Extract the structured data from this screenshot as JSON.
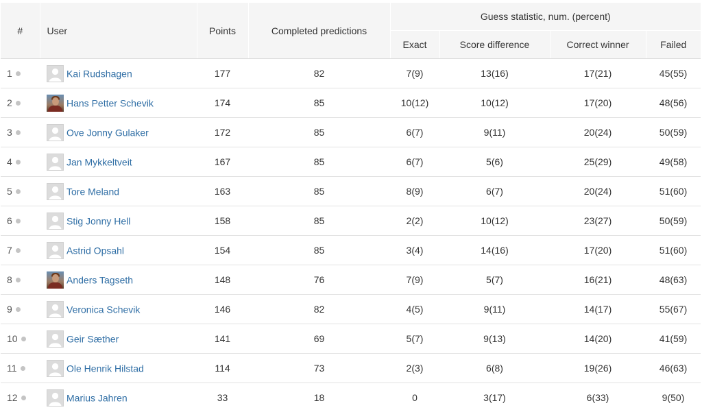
{
  "headers": {
    "rank": "#",
    "user": "User",
    "points": "Points",
    "completed": "Completed predictions",
    "group": "Guess statistic, num. (percent)",
    "exact": "Exact",
    "score_difference": "Score difference",
    "correct_winner": "Correct winner",
    "failed": "Failed"
  },
  "rows": [
    {
      "rank": "1",
      "name": "Kai Rudshagen",
      "avatar": "default-avatar-icon",
      "points": "177",
      "completed": "82",
      "exact": "7(9)",
      "score_difference": "13(16)",
      "correct_winner": "17(21)",
      "failed": "45(55)"
    },
    {
      "rank": "2",
      "name": "Hans Petter Schevik",
      "avatar": "photo-avatar",
      "points": "174",
      "completed": "85",
      "exact": "10(12)",
      "score_difference": "10(12)",
      "correct_winner": "17(20)",
      "failed": "48(56)"
    },
    {
      "rank": "3",
      "name": "Ove Jonny Gulaker",
      "avatar": "default-avatar-icon",
      "points": "172",
      "completed": "85",
      "exact": "6(7)",
      "score_difference": "9(11)",
      "correct_winner": "20(24)",
      "failed": "50(59)"
    },
    {
      "rank": "4",
      "name": "Jan Mykkeltveit",
      "avatar": "default-avatar-icon",
      "points": "167",
      "completed": "85",
      "exact": "6(7)",
      "score_difference": "5(6)",
      "correct_winner": "25(29)",
      "failed": "49(58)"
    },
    {
      "rank": "5",
      "name": "Tore Meland",
      "avatar": "default-avatar-icon",
      "points": "163",
      "completed": "85",
      "exact": "8(9)",
      "score_difference": "6(7)",
      "correct_winner": "20(24)",
      "failed": "51(60)"
    },
    {
      "rank": "6",
      "name": "Stig Jonny Hell",
      "avatar": "default-avatar-icon",
      "points": "158",
      "completed": "85",
      "exact": "2(2)",
      "score_difference": "10(12)",
      "correct_winner": "23(27)",
      "failed": "50(59)"
    },
    {
      "rank": "7",
      "name": "Astrid Opsahl",
      "avatar": "default-avatar-icon",
      "points": "154",
      "completed": "85",
      "exact": "3(4)",
      "score_difference": "14(16)",
      "correct_winner": "17(20)",
      "failed": "51(60)"
    },
    {
      "rank": "8",
      "name": "Anders Tagseth",
      "avatar": "photo-avatar",
      "points": "148",
      "completed": "76",
      "exact": "7(9)",
      "score_difference": "5(7)",
      "correct_winner": "16(21)",
      "failed": "48(63)"
    },
    {
      "rank": "9",
      "name": "Veronica Schevik",
      "avatar": "default-avatar-icon",
      "points": "146",
      "completed": "82",
      "exact": "4(5)",
      "score_difference": "9(11)",
      "correct_winner": "14(17)",
      "failed": "55(67)"
    },
    {
      "rank": "10",
      "name": "Geir Sæther",
      "avatar": "default-avatar-icon",
      "points": "141",
      "completed": "69",
      "exact": "5(7)",
      "score_difference": "9(13)",
      "correct_winner": "14(20)",
      "failed": "41(59)"
    },
    {
      "rank": "11",
      "name": "Ole Henrik Hilstad",
      "avatar": "default-avatar-icon",
      "points": "114",
      "completed": "73",
      "exact": "2(3)",
      "score_difference": "6(8)",
      "correct_winner": "19(26)",
      "failed": "46(63)"
    },
    {
      "rank": "12",
      "name": "Marius Jahren",
      "avatar": "default-avatar-icon",
      "points": "33",
      "completed": "18",
      "exact": "0",
      "score_difference": "3(17)",
      "correct_winner": "6(33)",
      "failed": "9(50)"
    }
  ],
  "colors": {
    "link": "#2f6ea5",
    "header_bg": "#f5f5f5",
    "status_dot": "#c4c4c4",
    "row_border": "#e2e2e2"
  }
}
